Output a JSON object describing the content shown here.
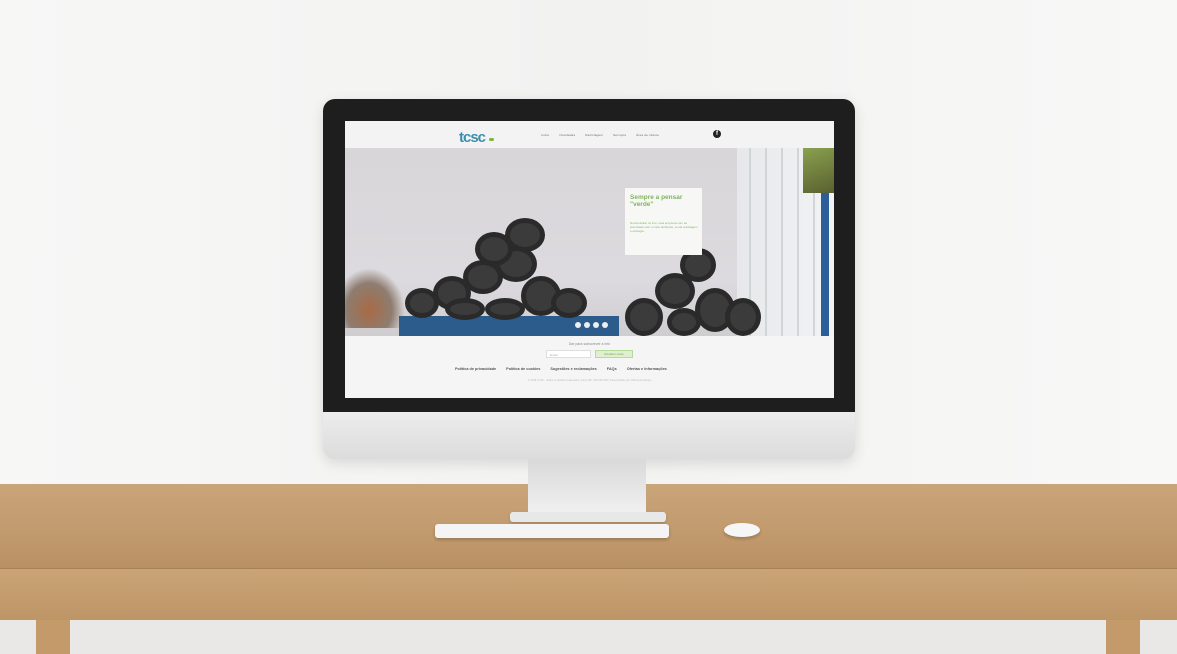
{
  "site": {
    "logo_text": "tcsc",
    "nav": [
      "Início",
      "Novidades",
      "Reciclagem",
      "Serviços",
      "Área de cliente"
    ],
    "social_icon": "facebook-icon",
    "facebook_glyph": "f"
  },
  "hero": {
    "promo_title": "Sempre a pensar \"verde\"",
    "promo_text": "Nunca deitar no lixo, uma empresa com as premissas com o meio ambiente, a sua reciclagem e ecologia.",
    "slide_count": 4
  },
  "footer": {
    "newsletter_label": "Dar para subscrever a info",
    "newsletter_placeholder": "Email",
    "newsletter_button": "Receber news",
    "links": [
      "Política de privacidade",
      "Política de cookies",
      "Sugestões e reclamações",
      "FAQs",
      "Ofertas e Informações"
    ],
    "copyright": "© 2015 TCSC - Todos os direitos reservados | Lda | NIF: 000 000 000 | Desenvolvido por Oficina de Design"
  },
  "colors": {
    "accent_green": "#7fb35e",
    "logo_blue": "#3b8fae",
    "container_blue": "#2b5c8b"
  }
}
